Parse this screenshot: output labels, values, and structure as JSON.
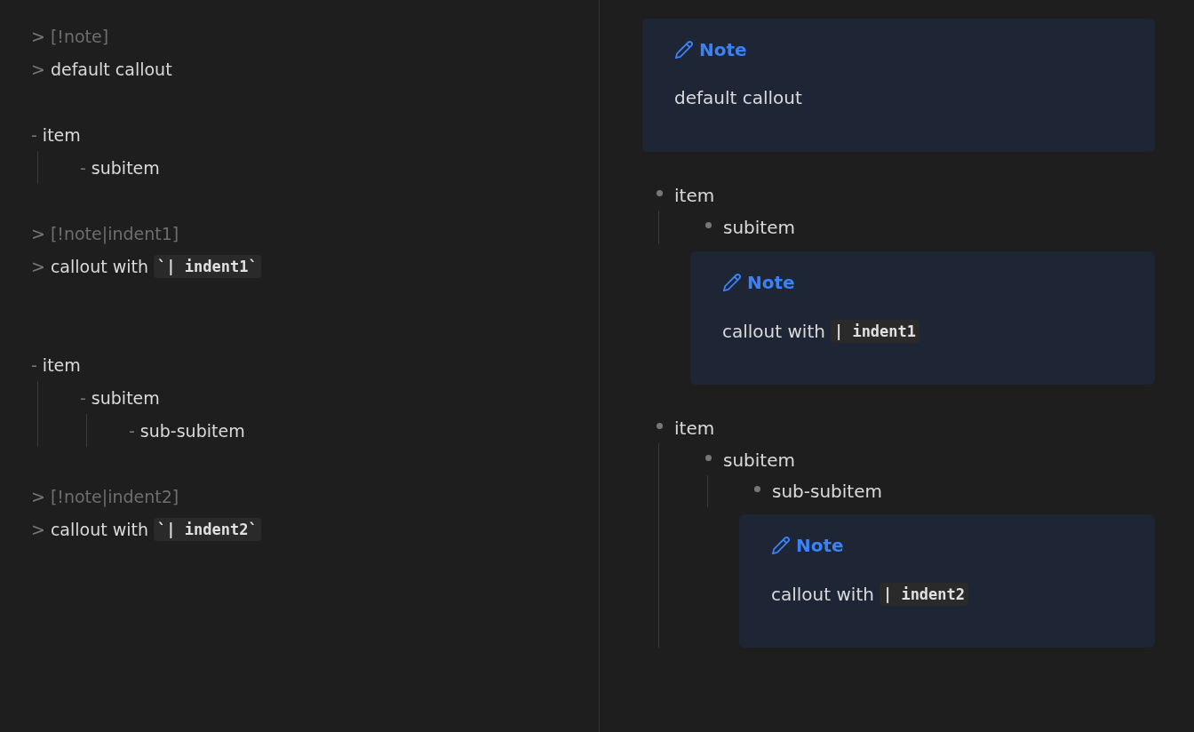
{
  "editor": {
    "blocks": [
      {
        "kind": "callout",
        "marker": ">",
        "header": "[!note]",
        "body_marker": ">",
        "body": "default callout"
      },
      {
        "kind": "list",
        "items": [
          {
            "marker": "-",
            "text": "item",
            "children": [
              {
                "marker": "-",
                "text": "subitem"
              }
            ]
          }
        ]
      },
      {
        "kind": "callout",
        "marker": ">",
        "header": "[!note|indent1]",
        "body_marker": ">",
        "body": "callout with ",
        "code": "`| indent1`"
      },
      {
        "kind": "list",
        "items": [
          {
            "marker": "-",
            "text": "item",
            "children": [
              {
                "marker": "-",
                "text": "subitem",
                "children": [
                  {
                    "marker": "-",
                    "text": "sub-subitem"
                  }
                ]
              }
            ]
          }
        ]
      },
      {
        "kind": "callout",
        "marker": ">",
        "header": "[!note|indent2]",
        "body_marker": ">",
        "body": "callout with ",
        "code": "`| indent2`"
      }
    ]
  },
  "preview": {
    "blocks": [
      {
        "kind": "callout",
        "title": "Note",
        "body": "default callout"
      },
      {
        "kind": "list",
        "items": [
          {
            "kind": "item",
            "text": "item",
            "children": [
              {
                "kind": "item",
                "text": "subitem"
              },
              {
                "kind": "callout",
                "title": "Note",
                "body": "callout with ",
                "code": "| indent1"
              }
            ]
          }
        ]
      },
      {
        "kind": "list",
        "items": [
          {
            "kind": "item",
            "text": "item",
            "children": [
              {
                "kind": "item",
                "text": "subitem",
                "children": [
                  {
                    "kind": "item",
                    "text": "sub-subitem"
                  },
                  {
                    "kind": "callout",
                    "title": "Note",
                    "body": "callout with ",
                    "code": "| indent2"
                  }
                ]
              }
            ]
          }
        ]
      }
    ]
  }
}
